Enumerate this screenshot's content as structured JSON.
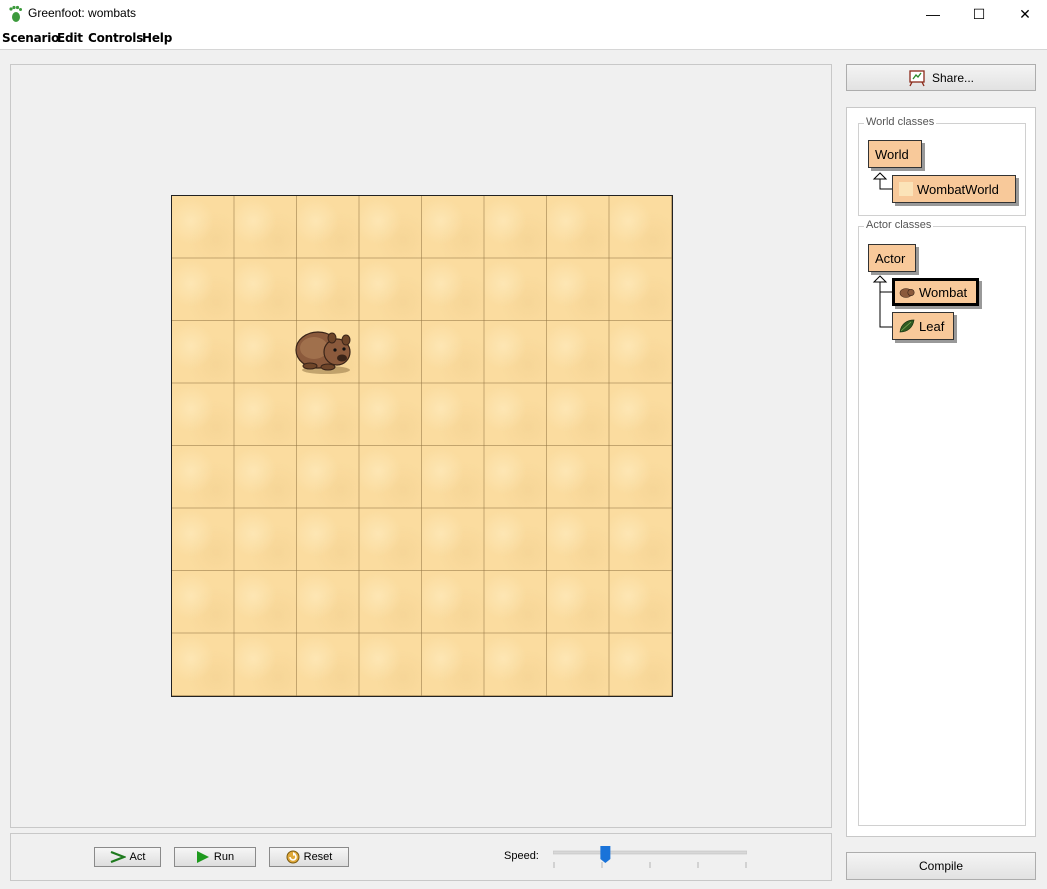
{
  "window": {
    "title": "Greenfoot: wombats",
    "minimize_glyph": "—",
    "maximize_glyph": "☐",
    "close_glyph": "✕"
  },
  "menu": [
    "Scenario",
    "Edit",
    "Controls",
    "Help"
  ],
  "share_label": "Share...",
  "world_classes": {
    "label": "World classes",
    "root": "World",
    "children": [
      "WombatWorld"
    ]
  },
  "actor_classes": {
    "label": "Actor classes",
    "root": "Actor",
    "children": [
      "Wombat",
      "Leaf"
    ],
    "selected": "Wombat"
  },
  "controls": {
    "act_label": "Act",
    "run_label": "Run",
    "reset_label": "Reset",
    "speed_label": "Speed:",
    "speed_value_fraction": 0.27
  },
  "compile_label": "Compile",
  "world": {
    "columns": 8,
    "rows": 8,
    "actors": [
      {
        "type": "Wombat",
        "cell": [
          2,
          2
        ]
      }
    ]
  },
  "icons": {
    "app": "greenfoot-footprint-icon",
    "share": "share-easel-icon",
    "act": "act-arrow-icon",
    "run": "play-icon",
    "reset": "reset-icon",
    "wombat": "wombat-icon",
    "leaf": "leaf-icon"
  },
  "colors": {
    "class_box": "#f8c99a",
    "world_bg": "#fbdc9f",
    "slider_thumb": "#1a73d9",
    "run_green": "#1e9a1e"
  }
}
